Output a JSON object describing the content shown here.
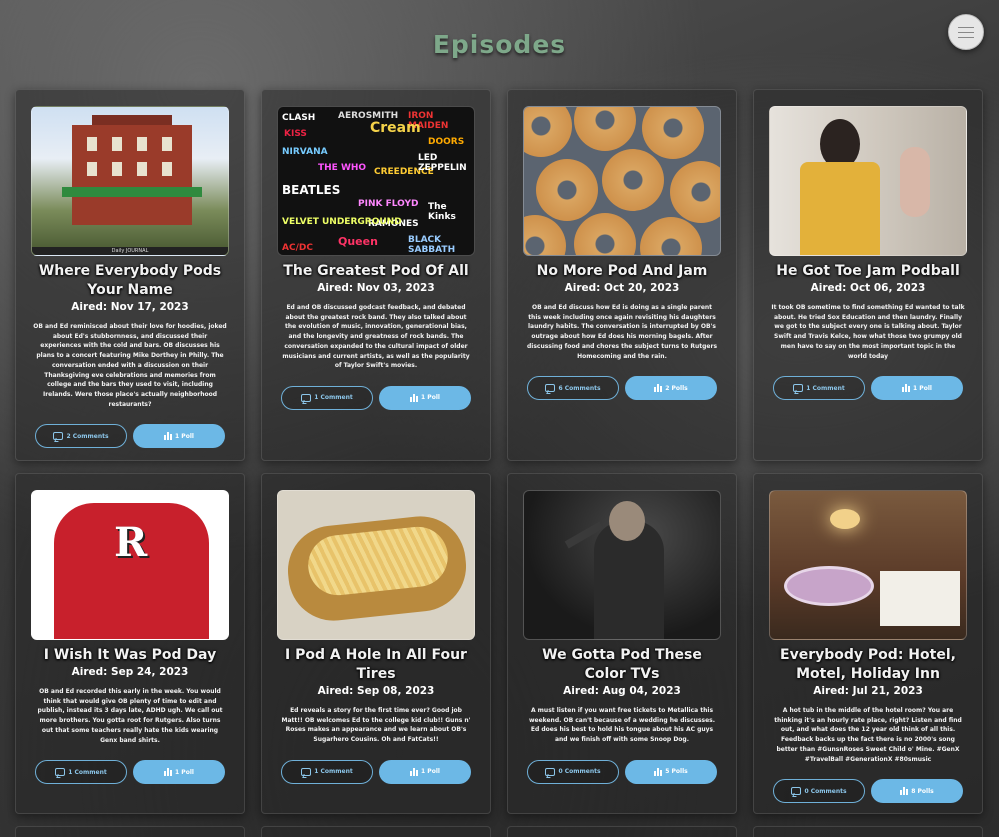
{
  "page": {
    "title": "Episodes"
  },
  "menu": {
    "icon": "hamburger-menu-icon"
  },
  "colors": {
    "title": "#7ea88a",
    "accent": "#6cb8e6"
  },
  "episodes": [
    {
      "title": "Where Everybody Pods Your Name",
      "aired": "Aired: Nov 17, 2023",
      "description": "OB and Ed reminisced about their love for hoodies, joked about Ed's stubbornness, and discussed their experiences with the cold and bars. OB discusses his plans to a concert featuring Mike Dorthey in Philly. The conversation ended with a discussion on their Thanksgiving eve celebrations and memories from college and the bars they used to visit, including Irelands. Were those place's actually neighborhood restaurants?",
      "comments": "2 Comments",
      "polls": "1 Poll",
      "image_caption": "Daily JOURNAL"
    },
    {
      "title": "The Greatest Pod Of All",
      "aired": "Aired: Nov 03, 2023",
      "description": "Ed and OB discussed godcast feedback, and debated about the greatest rock band. They also talked about the evolution of music, innovation, generational bias, and the longevity and greatness of rock bands. The conversation expanded to the cultural impact of older musicians and current artists, as well as the popularity of Taylor Swift's movies.",
      "comments": "1 Comment",
      "polls": "1 Poll",
      "image_words": [
        "CLASH",
        "AEROSMITH",
        "IRON MAIDEN",
        "KISS",
        "Cream",
        "NIRVANA",
        "DOORS",
        "THE WHO",
        "CREEDENCE",
        "LED ZEPPELIN",
        "BEATLES",
        "PINK FLOYD",
        "RAMONES",
        "VELVET UNDERGROUND",
        "Queen",
        "BLACK SABBATH",
        "AC/DC",
        "The Kinks"
      ]
    },
    {
      "title": "No More Pod And Jam",
      "aired": "Aired: Oct 20, 2023",
      "description": "OB and Ed discuss how Ed is doing as a single parent this week including once again revisiting his daughters laundry habits. The conversation is interrupted by OB's outrage about how Ed does his morning bagels. After discussing food and chores the subject turns to Rutgers Homecoming and the rain.",
      "comments": "6 Comments",
      "polls": "2 Polls"
    },
    {
      "title": "He Got Toe Jam Podball",
      "aired": "Aired: Oct 06, 2023",
      "description": "It took OB sometime to find something Ed wanted to talk about. He tried Sox Education and then laundry. Finally we got to the subject every one is talking about. Taylor Swift and Travis Kelce, how what those two grumpy old men have to say on the most important topic in the world today",
      "comments": "1 Comment",
      "polls": "1 Poll"
    },
    {
      "title": "I Wish It Was Pod Day",
      "aired": "Aired: Sep 24, 2023",
      "description": "OB and Ed recorded this early in the week. You would think that would give OB plenty of time to edit and publish, instead its 3 days late, ADHD ugh. We call out more brothers. You gotta root for Rutgers. Also turns out that some teachers really hate the kids wearing Genx band shirts.",
      "comments": "1 Comment",
      "polls": "1 Poll",
      "image_letter": "R"
    },
    {
      "title": "I Pod A Hole In All Four Tires",
      "aired": "Aired: Sep 08, 2023",
      "description": "Ed reveals a story for the first time ever? Good job Matt!! OB welcomes Ed to the college kid club!! Guns n' Roses makes an appearance and we learn about OB's Sugarhero Cousins. Oh and FatCats!!",
      "comments": "1 Comment",
      "polls": "1 Poll"
    },
    {
      "title": "We Gotta Pod These Color TVs",
      "aired": "Aired: Aug 04, 2023",
      "description": "A must listen if you want free tickets to Metallica this weekend. OB can't because of a wedding he discusses. Ed does his best to hold his tongue about his AC guys and we finish off with some Snoop Dog.",
      "comments": "0 Comments",
      "polls": "5 Polls"
    },
    {
      "title": "Everybody Pod: Hotel, Motel, Holiday Inn",
      "aired": "Aired: Jul 21, 2023",
      "description": "A hot tub in the middle of the hotel room? You are thinking it's an hourly rate place, right? Listen and find out, and what does the 12 year old think of all this. Feedback backs up the fact there is no 2000's song better than #GunsnRoses Sweet Child o' Mine. #GenX #TravelBall #GenerationX #80smusic",
      "comments": "0 Comments",
      "polls": "8 Polls"
    }
  ]
}
